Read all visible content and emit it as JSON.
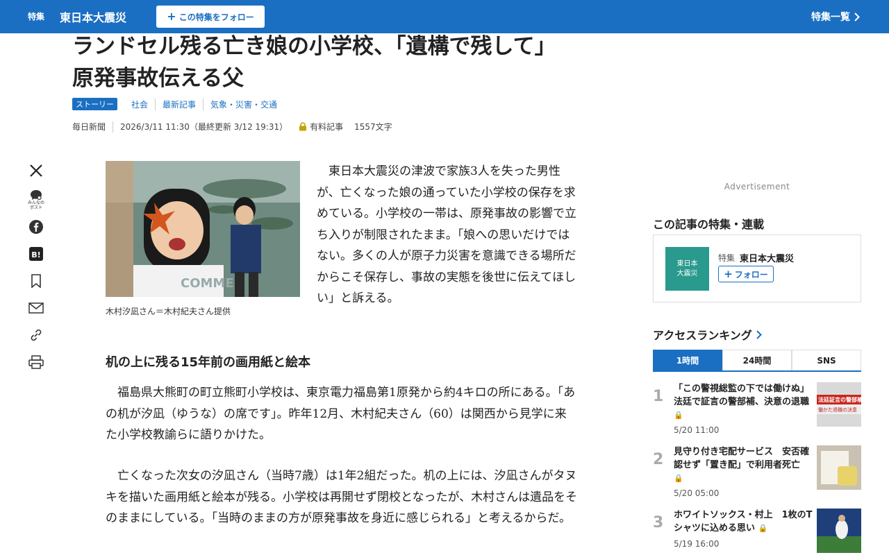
{
  "topbar": {
    "feature_label": "特集",
    "feature_title": "東日本大震災",
    "follow_label": "この特集をフォロー",
    "list_label": "特集一覧"
  },
  "headline": {
    "line1": "ランドセル残る亡き娘の小学校、「遺構で残して」",
    "line2": "原発事故伝える父"
  },
  "tags": {
    "story": "ストーリー",
    "items": [
      "社会",
      "最新記事",
      "気象・災害・交通"
    ]
  },
  "meta": {
    "source": "毎日新聞",
    "date": "2026/3/11 11:30（最終更新 3/12 19:31）",
    "paid": "有料記事",
    "chars": "1557文字"
  },
  "share": {
    "minna_caption_1": "みんなの",
    "minna_caption_2": "ポスト"
  },
  "article": {
    "photo_text": "COMME",
    "caption": "木村汐凪さん＝木村紀夫さん提供",
    "lead": "　東日本大震災の津波で家族3人を失った男性が、亡くなった娘の通っていた小学校の保存を求めている。小学校の一帯は、原発事故の影響で立ち入りが制限されたまま。「娘への思いだけではない。多くの人が原子力災害を意識できる場所だからこそ保存し、事故の実態を後世に伝えてほしい」と訴える。",
    "subheading": "机の上に残る15年前の画用紙と絵本",
    "para1": "　福島県大熊町の町立熊町小学校は、東京電力福島第1原発から約4キロの所にある。「あの机が汐凪（ゆうな）の席です」。昨年12月、木村紀夫さん（60）は関西から見学に来た小学校教諭らに語りかけた。",
    "para2": "　亡くなった次女の汐凪さん（当時7歳）は1年2組だった。机の上には、汐凪さんがタヌキを描いた画用紙と絵本が残る。小学校は再開せず閉校となったが、木村さんは遺品をそのままにしている。「当時のままの方が原発事故を身近に感じられる」と考えるからだ。"
  },
  "sidebar": {
    "advertisement": "Advertisement",
    "feature_heading": "この記事の特集・連載",
    "feature_thumb_1": "東日本",
    "feature_thumb_2": "大震災",
    "feature_label": "特集",
    "feature_name": "東日本大震災",
    "feature_follow": "フォロー",
    "ranking_heading": "アクセスランキング",
    "tabs": [
      "1時間",
      "24時間",
      "SNS"
    ],
    "ranking": [
      {
        "num": "1",
        "title": "「この警視総監の下では働けぬ」法廷で証言の警部補、決意の退職",
        "date": "5/20 11:00"
      },
      {
        "num": "2",
        "title": "見守り付き宅配サービス　安否確認せず「置き配」で利用者死亡",
        "date": "5/20 05:00"
      },
      {
        "num": "3",
        "title": "ホワイトソックス・村上　1枚のTシャツに込める思い",
        "date": "5/19 16:00"
      }
    ],
    "rank1_img_text_1": "法廷証言の警部補",
    "rank1_img_text_2": "働かた退職の決意"
  },
  "colors": {
    "brand_blue": "#1b6fc2",
    "lock_gold": "#c8a000",
    "feature_teal": "#2a9a8e"
  }
}
